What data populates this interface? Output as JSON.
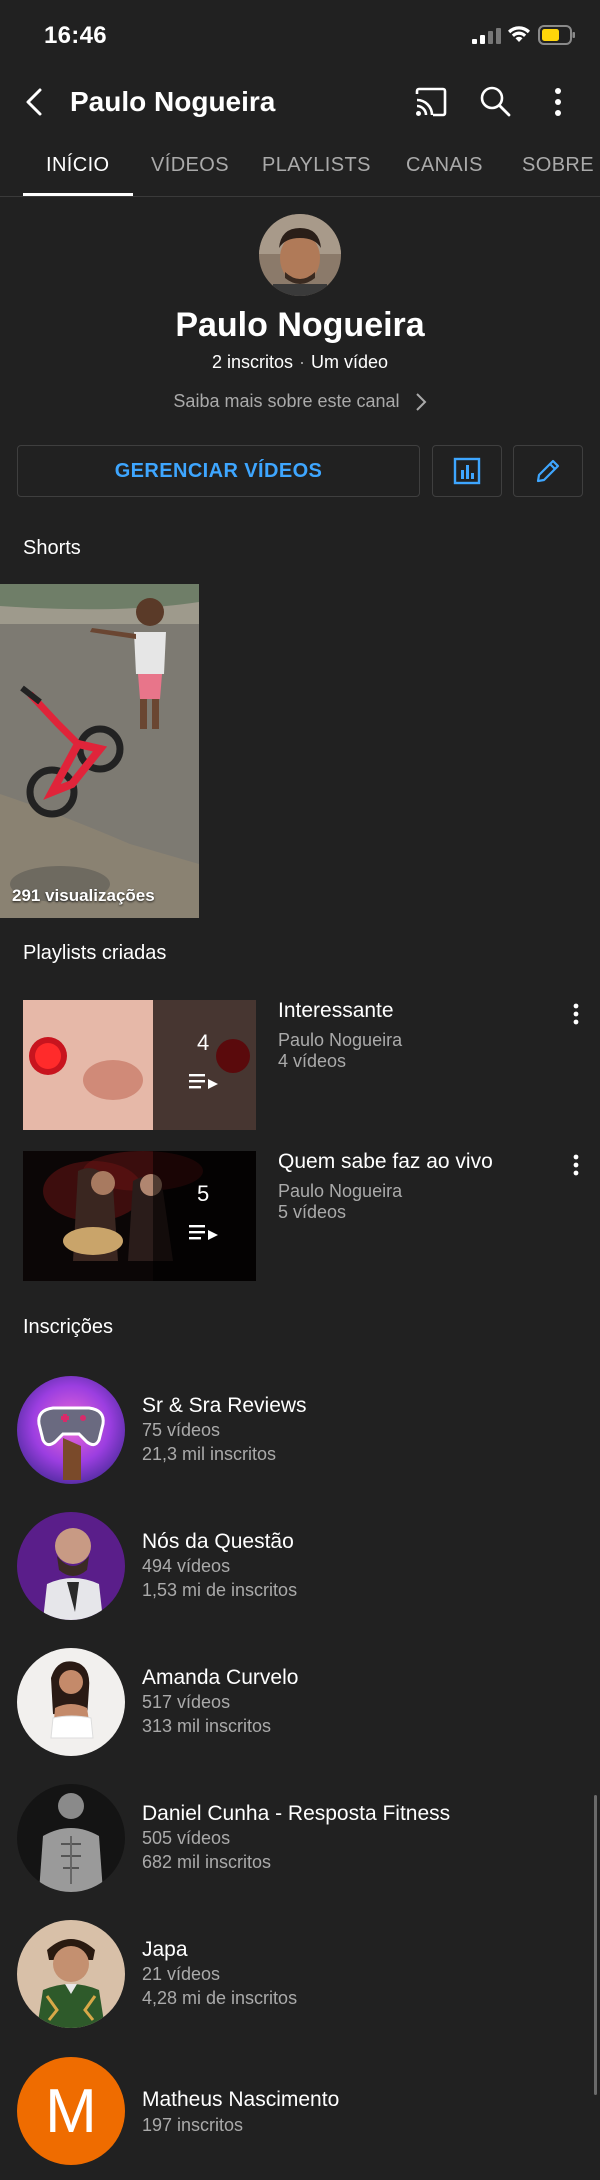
{
  "status": {
    "time": "16:46"
  },
  "header": {
    "title": "Paulo Nogueira"
  },
  "tabs": [
    {
      "label": "INÍCIO",
      "active": true
    },
    {
      "label": "VÍDEOS"
    },
    {
      "label": "PLAYLISTS"
    },
    {
      "label": "CANAIS"
    },
    {
      "label": "SOBRE"
    }
  ],
  "channel": {
    "name": "Paulo Nogueira",
    "subscribers": "2 inscritos",
    "videos": "Um vídeo",
    "about_link": "Saiba mais sobre este canal"
  },
  "actions": {
    "manage_label": "GERENCIAR VÍDEOS"
  },
  "shorts": {
    "title": "Shorts",
    "items": [
      {
        "views": "291 visualizações"
      }
    ]
  },
  "playlists": {
    "title": "Playlists criadas",
    "items": [
      {
        "title": "Interessante",
        "owner": "Paulo Nogueira",
        "videos": "4 vídeos",
        "count": "4"
      },
      {
        "title": "Quem sabe faz ao vivo",
        "owner": "Paulo Nogueira",
        "videos": "5 vídeos",
        "count": "5"
      }
    ]
  },
  "subscriptions": {
    "title": "Inscrições",
    "items": [
      {
        "name": "Sr & Sra Reviews",
        "videos": "75 vídeos",
        "subs": "21,3 mil inscritos"
      },
      {
        "name": "Nós da Questão",
        "videos": "494 vídeos",
        "subs": "1,53 mi de inscritos"
      },
      {
        "name": "Amanda Curvelo",
        "videos": "517 vídeos",
        "subs": "313 mil inscritos"
      },
      {
        "name": "Daniel Cunha - Resposta Fitness",
        "videos": "505 vídeos",
        "subs": "682 mil inscritos"
      },
      {
        "name": "Japa",
        "videos": "21 vídeos",
        "subs": "4,28 mi de inscritos"
      },
      {
        "name": "Matheus Nascimento",
        "videos": "197 inscritos",
        "initial": "M"
      }
    ]
  },
  "colors": {
    "background": "#212121",
    "accent": "#3ea6ff",
    "muted": "#aaaaaa",
    "avatar_orange": "#ef6c00"
  }
}
